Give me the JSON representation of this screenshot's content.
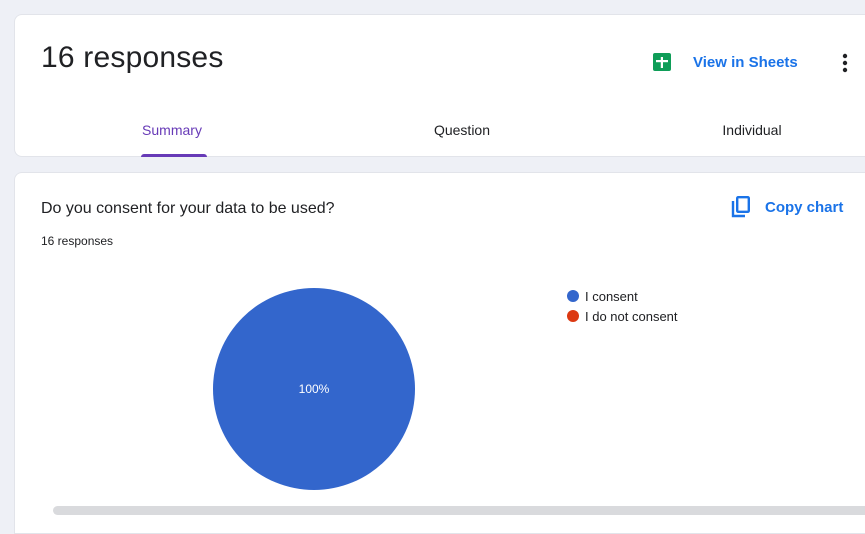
{
  "header": {
    "title": "16 responses",
    "sheets_label": "View in Sheets"
  },
  "tabs": [
    {
      "label": "Summary",
      "active": true
    },
    {
      "label": "Question",
      "active": false
    },
    {
      "label": "Individual",
      "active": false
    }
  ],
  "summary": {
    "question": "Do you consent for your data to be used?",
    "response_count": "16 responses",
    "copy_label": "Copy chart"
  },
  "colors": {
    "accent": "#673ab7",
    "link": "#1a73e8",
    "sheets_green": "#0f9d58"
  },
  "icons": {
    "sheets": "google-sheets-icon",
    "more": "more-vert-icon",
    "copy": "copy-icon"
  },
  "chart_data": {
    "type": "pie",
    "categories": [
      "I consent",
      "I do not consent"
    ],
    "values": [
      100,
      0
    ],
    "value_labels": [
      "100%",
      ""
    ],
    "colors": [
      "#3366cc",
      "#dc3912"
    ],
    "legend": "right"
  }
}
